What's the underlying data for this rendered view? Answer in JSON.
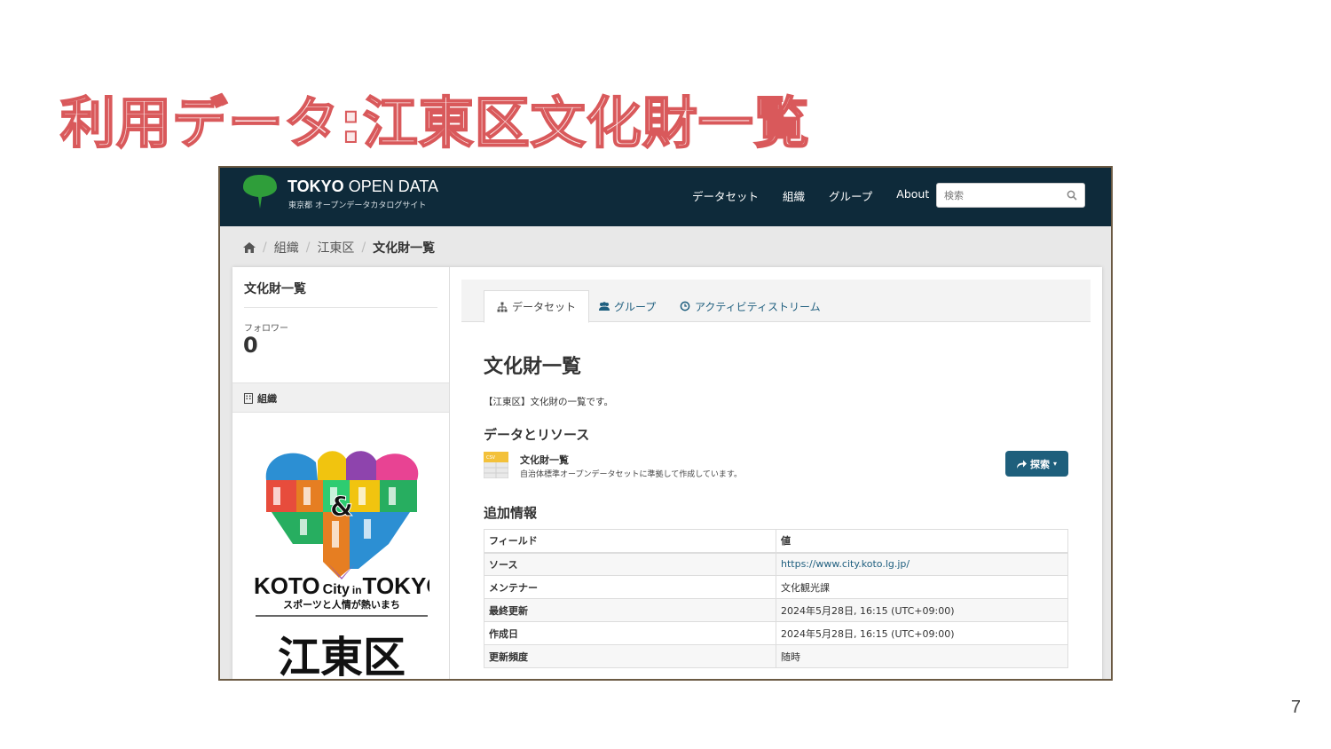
{
  "slide": {
    "title": "利用データ:江東区文化財一覧",
    "page_number": "7"
  },
  "navbar": {
    "brand_bold": "TOKYO",
    "brand_rest": " OPEN DATA",
    "brand_sub": "東京都 オープンデータカタログサイト",
    "links": [
      "データセット",
      "組織",
      "グループ",
      "About"
    ],
    "search_placeholder": "検索"
  },
  "breadcrumb": {
    "items": [
      "組織",
      "江東区"
    ],
    "current": "文化財一覧"
  },
  "sidebar": {
    "title": "文化財一覧",
    "followers_label": "フォロワー",
    "followers_count": "0",
    "org_label": "組織",
    "logo_text": {
      "koto": "KOTO",
      "city": "City",
      "in": "in",
      "tokyo": "TOKYO",
      "tagline": "スポーツと人情が熱いまち",
      "ward": "江東区"
    }
  },
  "tabs": [
    {
      "label": "データセット",
      "icon": "sitemap-icon",
      "active": true
    },
    {
      "label": "グループ",
      "icon": "users-icon",
      "active": false
    },
    {
      "label": "アクティビティストリーム",
      "icon": "clock-icon",
      "active": false
    }
  ],
  "dataset": {
    "title": "文化財一覧",
    "description": "【江東区】文化財の一覧です。",
    "resources_heading": "データとリソース",
    "resource": {
      "format": "CSV",
      "name": "文化財一覧",
      "description": "自治体標準オープンデータセットに準拠して作成しています。",
      "explore_label": "探索"
    },
    "additional_heading": "追加情報",
    "table": {
      "headers": [
        "フィールド",
        "値"
      ],
      "rows": [
        {
          "key": "ソース",
          "value": "https://www.city.koto.lg.jp/"
        },
        {
          "key": "メンテナー",
          "value": "文化観光課"
        },
        {
          "key": "最終更新",
          "value": "2024年5月28日, 16:15 (UTC+09:00)"
        },
        {
          "key": "作成日",
          "value": "2024年5月28日, 16:15 (UTC+09:00)"
        },
        {
          "key": "更新頻度",
          "value": "随時"
        }
      ]
    }
  },
  "colors": {
    "title_stroke": "#d9595b",
    "navbar_bg": "#0e2a3a",
    "link": "#1f5f7f",
    "button": "#1e5f7c"
  }
}
